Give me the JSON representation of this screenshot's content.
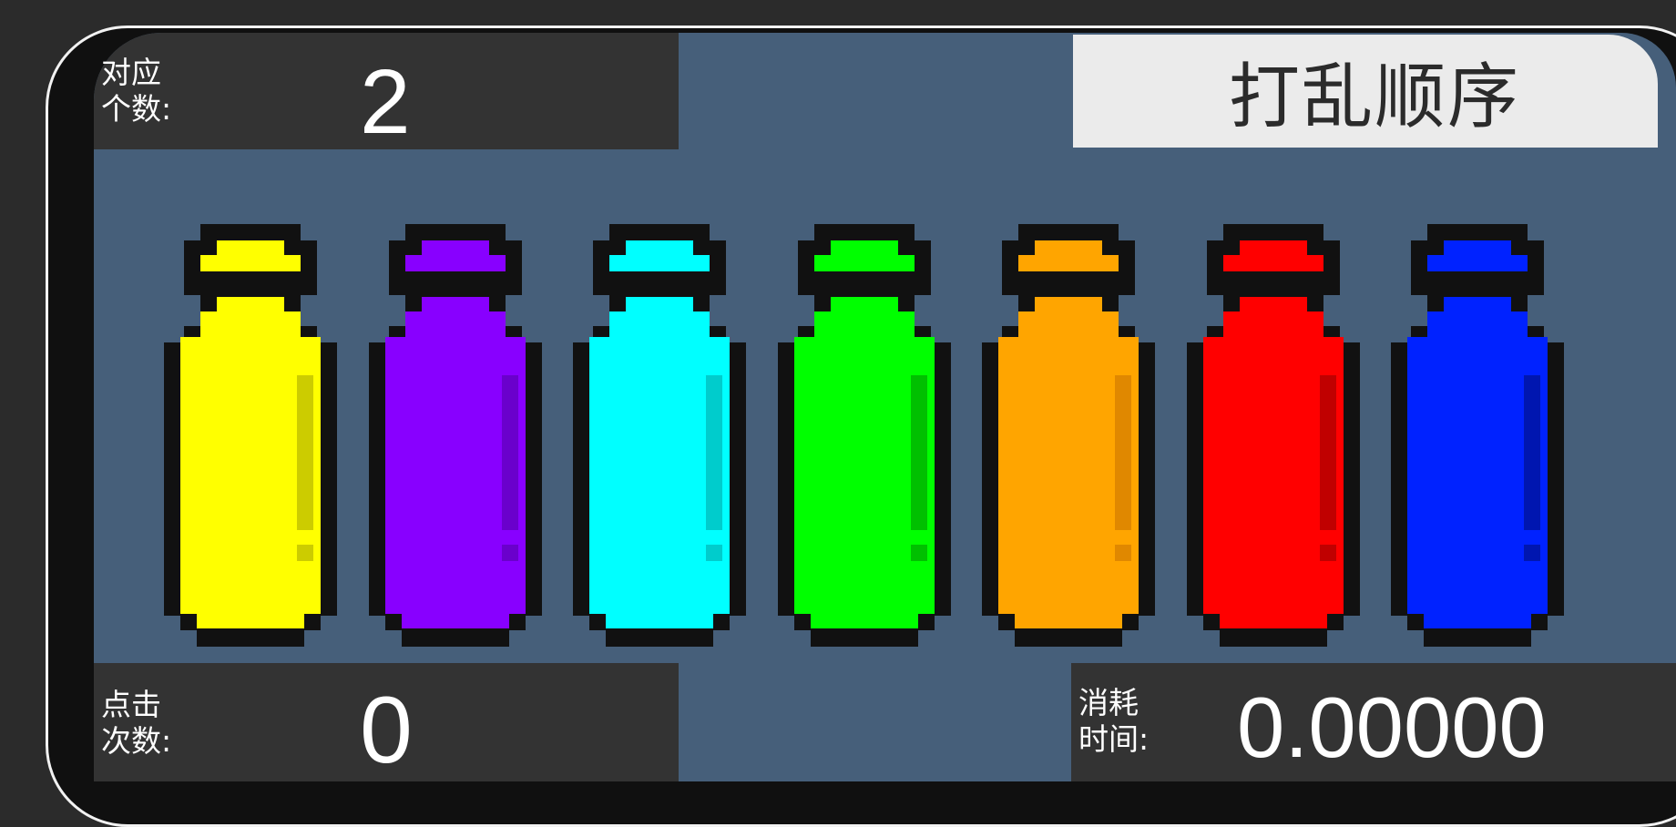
{
  "stats": {
    "match_label": "对应\n个数:",
    "match_value": "2",
    "click_label": "点击\n次数:",
    "click_value": "0",
    "time_label": "消耗\n时间:",
    "time_value": "0.00000"
  },
  "shuffle_button": {
    "label": "打乱顺序"
  },
  "bottles": [
    {
      "color_name": "yellow",
      "body": "#ffff00",
      "cap": "#ffff00",
      "shine": "#cccc00"
    },
    {
      "color_name": "purple",
      "body": "#8800ff",
      "cap": "#8800ff",
      "shine": "#6a00cc"
    },
    {
      "color_name": "cyan",
      "body": "#00ffff",
      "cap": "#00ffff",
      "shine": "#00cccc"
    },
    {
      "color_name": "green",
      "body": "#00ff00",
      "cap": "#00ff00",
      "shine": "#00c000"
    },
    {
      "color_name": "orange",
      "body": "#ffa500",
      "cap": "#ffa500",
      "shine": "#e08800"
    },
    {
      "color_name": "red",
      "body": "#ff0000",
      "cap": "#ff0000",
      "shine": "#c00000"
    },
    {
      "color_name": "blue",
      "body": "#0022ff",
      "cap": "#0022ff",
      "shine": "#0016b0"
    }
  ],
  "colors": {
    "background": "#465f7a",
    "panel": "#333333",
    "button": "#ebebeb",
    "outline": "#111111"
  }
}
